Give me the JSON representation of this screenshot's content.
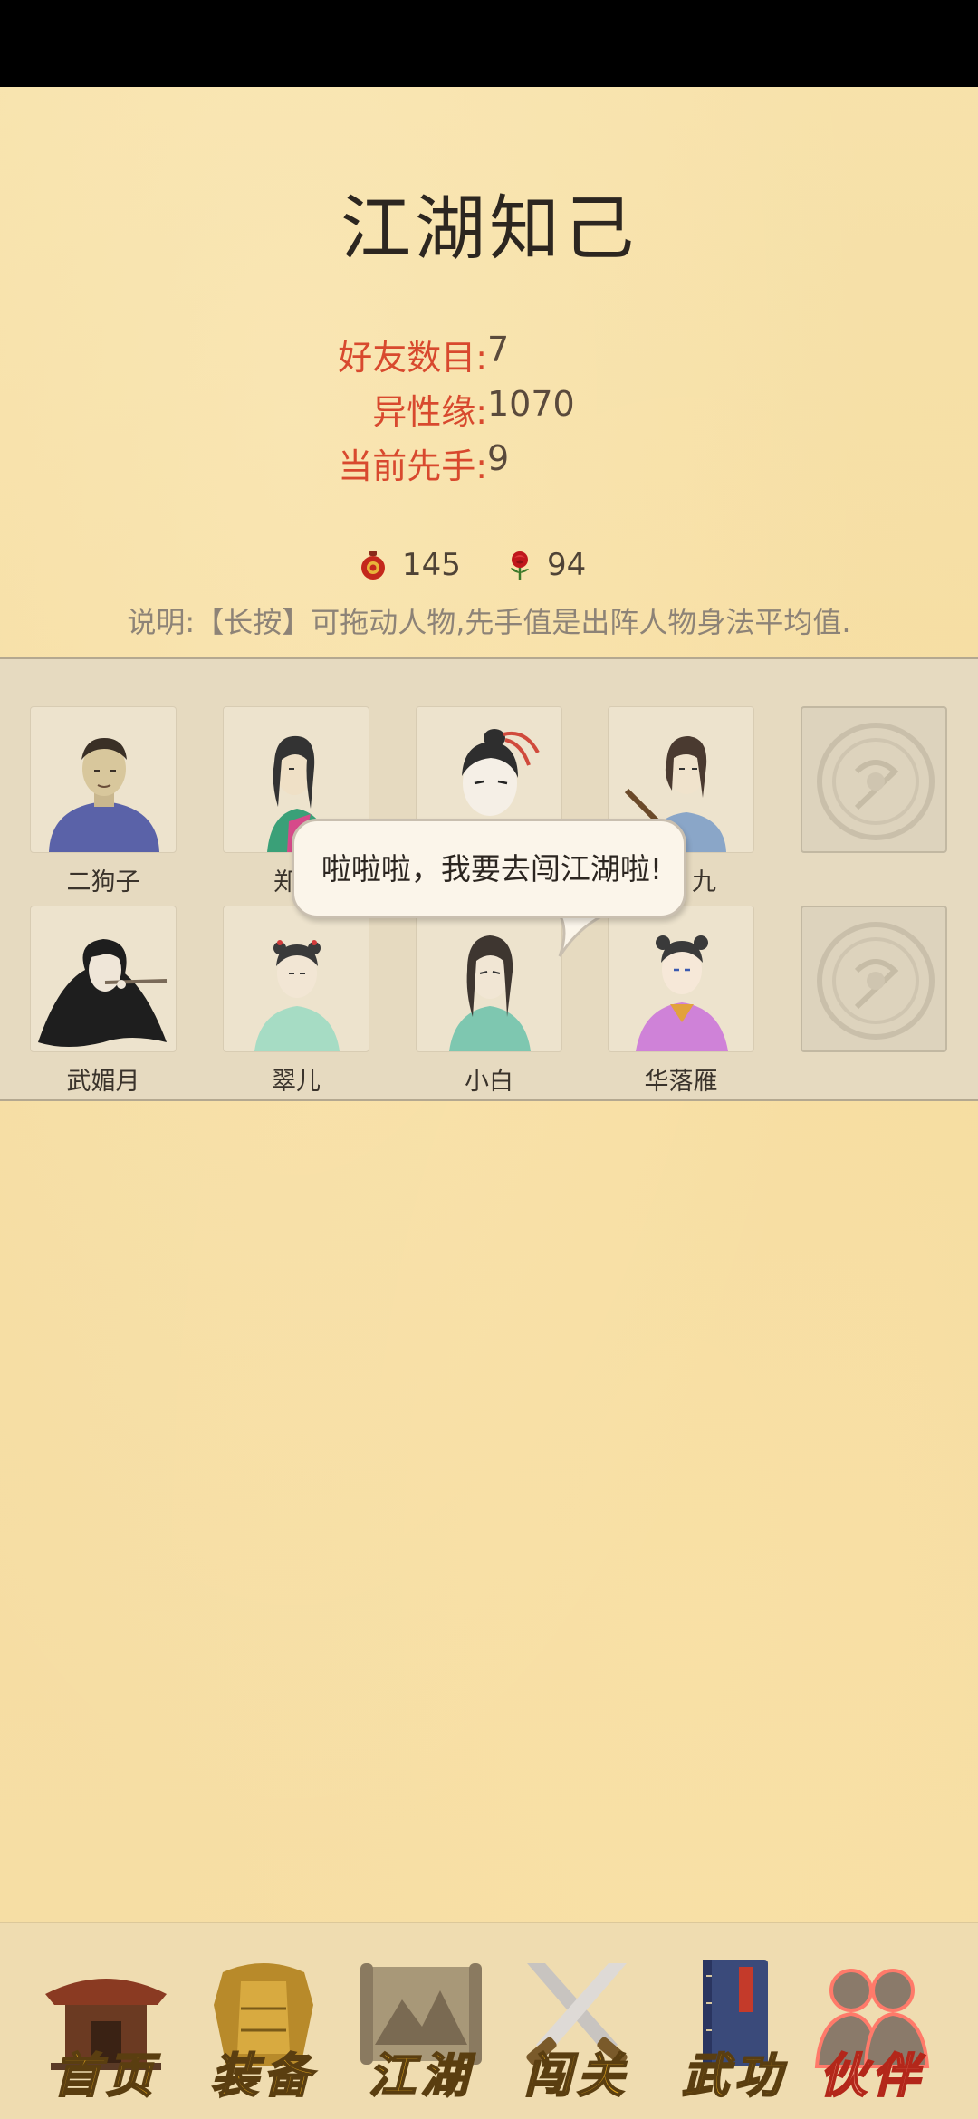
{
  "page": {
    "title": "江湖知己"
  },
  "stats": {
    "friends": {
      "label": "好友数目:",
      "value": "7"
    },
    "charm": {
      "label": "异性缘:",
      "value": "1070"
    },
    "initiative": {
      "label": "当前先手:",
      "value": "9"
    }
  },
  "currency": {
    "gourd": {
      "icon": "gourd-icon",
      "value": "145"
    },
    "rose": {
      "icon": "rose-icon",
      "value": "94"
    }
  },
  "instruction": "说明:【长按】可拖动人物,先手值是出阵人物身法平均值.",
  "bubble": {
    "text": "啦啦啦，我要去闯江湖啦!"
  },
  "companions_row1": [
    {
      "name": "二狗子"
    },
    {
      "name": "郑"
    },
    {
      "name": ""
    },
    {
      "name": "九"
    }
  ],
  "companions_row2": [
    {
      "name": "武媚月"
    },
    {
      "name": "翠儿"
    },
    {
      "name": "小白"
    },
    {
      "name": "华落雁"
    }
  ],
  "nav": [
    {
      "label": "首页",
      "icon": "house-icon"
    },
    {
      "label": "装备",
      "icon": "armor-icon"
    },
    {
      "label": "江湖",
      "icon": "map-scroll-icon"
    },
    {
      "label": "闯关",
      "icon": "crossed-swords-icon"
    },
    {
      "label": "武功",
      "icon": "book-icon"
    },
    {
      "label": "伙伴",
      "icon": "companions-icon",
      "active": true
    }
  ],
  "colors": {
    "label_red": "#d8492e",
    "nav_gold": "#e5a81e",
    "nav_active": "#f3a08a"
  }
}
